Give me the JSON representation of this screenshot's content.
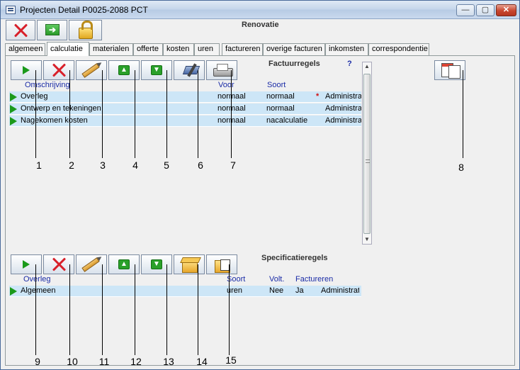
{
  "window": {
    "title": "Projecten Detail   P0025-2088   PCT",
    "min_glyph": "—",
    "max_glyph": "▢",
    "close_glyph": "✕"
  },
  "project": {
    "name": "Renovatie"
  },
  "tabs": [
    {
      "label": "algemeen",
      "active": false
    },
    {
      "label": "calculatie",
      "active": true
    },
    {
      "label": "materialen",
      "active": false
    },
    {
      "label": "offerte",
      "active": false
    },
    {
      "label": "kosten",
      "active": false
    },
    {
      "label": "uren",
      "active": false
    },
    {
      "label": "factureren",
      "active": false
    },
    {
      "label": "overige facturen",
      "active": false
    },
    {
      "label": "inkomsten",
      "active": false
    },
    {
      "label": "correspondentie",
      "active": false
    }
  ],
  "factuurregels": {
    "title": "Factuurregels",
    "help": "?",
    "columns": {
      "omschrijving": "Omschrijving",
      "voor": "Voor",
      "soort": "Soort"
    },
    "rows": [
      {
        "omschrijving": "Overleg",
        "voor": "normaal",
        "soort": "normaal",
        "marker": "*",
        "extra": "Administratie"
      },
      {
        "omschrijving": "Ontwerp en tekeningen",
        "voor": "normaal",
        "soort": "normaal",
        "marker": "",
        "extra": "Administratie"
      },
      {
        "omschrijving": "Nagekomen kosten",
        "voor": "normaal",
        "soort": "nacalculatie",
        "marker": "",
        "extra": "Administratie"
      }
    ]
  },
  "specificatieregels": {
    "title": "Specificatieregels",
    "columns": {
      "overleg": "Overleg",
      "soort": "Soort",
      "volt": "Volt.",
      "factureren": "Factureren"
    },
    "rows": [
      {
        "omschrijving": "Algemeen",
        "soort": "uren",
        "volt": "Nee",
        "factureren": "Ja",
        "extra": "Administratie"
      }
    ]
  },
  "icons": {
    "up": "▲",
    "down": "▼",
    "green_arrow": "➔",
    "scroll_up": "▲",
    "scroll_down": "▼"
  },
  "callouts": [
    "1",
    "2",
    "3",
    "4",
    "5",
    "6",
    "7",
    "8",
    "9",
    "10",
    "11",
    "12",
    "13",
    "14",
    "15"
  ],
  "colors": {
    "accent_link": "#1a2ba6",
    "row_bg": "#cde6f7",
    "marker": "#d01010"
  }
}
